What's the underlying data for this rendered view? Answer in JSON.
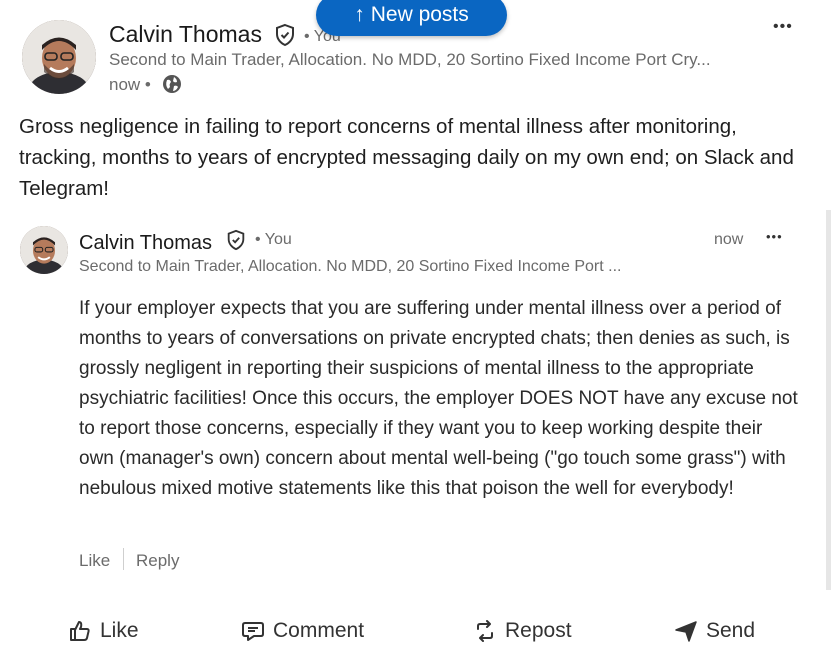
{
  "new_posts": {
    "label": "New posts",
    "arrow": "↑"
  },
  "post": {
    "author": "Calvin Thomas",
    "you": "• You",
    "headline": "Second to Main Trader, Allocation. No MDD, 20 Sortino Fixed Income Port Cry...",
    "time": "now •",
    "text": "Gross negligence in failing to report concerns of mental illness after monitoring, tracking, months to years of encrypted messaging daily on my own end; on Slack and Telegram!",
    "menu": "•••"
  },
  "comment": {
    "author": "Calvin Thomas",
    "you": "• You",
    "headline": "Second to Main Trader, Allocation. No MDD, 20 Sortino Fixed Income Port ...",
    "time": "now",
    "menu": "•••",
    "text": "If your employer expects that you are suffering under mental illness over a period of months to years of conversations on private encrypted chats; then denies as such, is grossly negligent in reporting their suspicions of mental illness to the appropriate psychiatric facilities! Once this occurs, the employer DOES NOT have any excuse not to report those concerns, especially if they want you to keep working despite their own (manager's own) concern about mental well-being (\"go touch some grass\") with nebulous mixed motive statements like this that poison the well for everybody!",
    "like": "Like",
    "reply": "Reply"
  },
  "actions": {
    "like": "Like",
    "comment": "Comment",
    "repost": "Repost",
    "send": "Send"
  },
  "colors": {
    "accent": "#0a66c2",
    "muted": "#6b6b6b"
  },
  "icons": [
    "verified-shield-icon",
    "globe-icon",
    "thumbs-up-icon",
    "comment-icon",
    "repost-icon",
    "send-icon",
    "more-icon",
    "arrow-up-icon"
  ]
}
